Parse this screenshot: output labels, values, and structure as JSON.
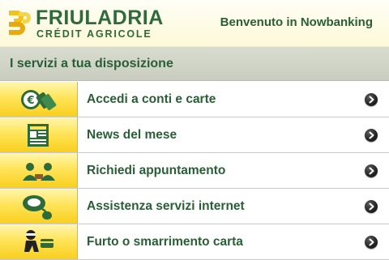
{
  "header": {
    "brand_name": "FRIULADRIA",
    "brand_sub": "CRÉDIT AGRICOLE",
    "welcome": "Benvenuto in Nowbanking"
  },
  "section": {
    "title": "I servizi a tua disposizione"
  },
  "menu": {
    "items": [
      {
        "label": "Accedi a conti e carte",
        "icon": "euro-coins-icon"
      },
      {
        "label": "News del mese",
        "icon": "newspaper-icon"
      },
      {
        "label": "Richiedi appuntamento",
        "icon": "people-meeting-icon"
      },
      {
        "label": "Assistenza servizi internet",
        "icon": "support-mouse-icon"
      },
      {
        "label": "Furto o smarrimento carta",
        "icon": "thief-card-icon"
      }
    ]
  },
  "colors": {
    "brand_green": "#2d6b3a",
    "label_green": "#2a5e36",
    "icon_yellow": "#ffe45a",
    "section_gray": "#d0d4c7"
  }
}
